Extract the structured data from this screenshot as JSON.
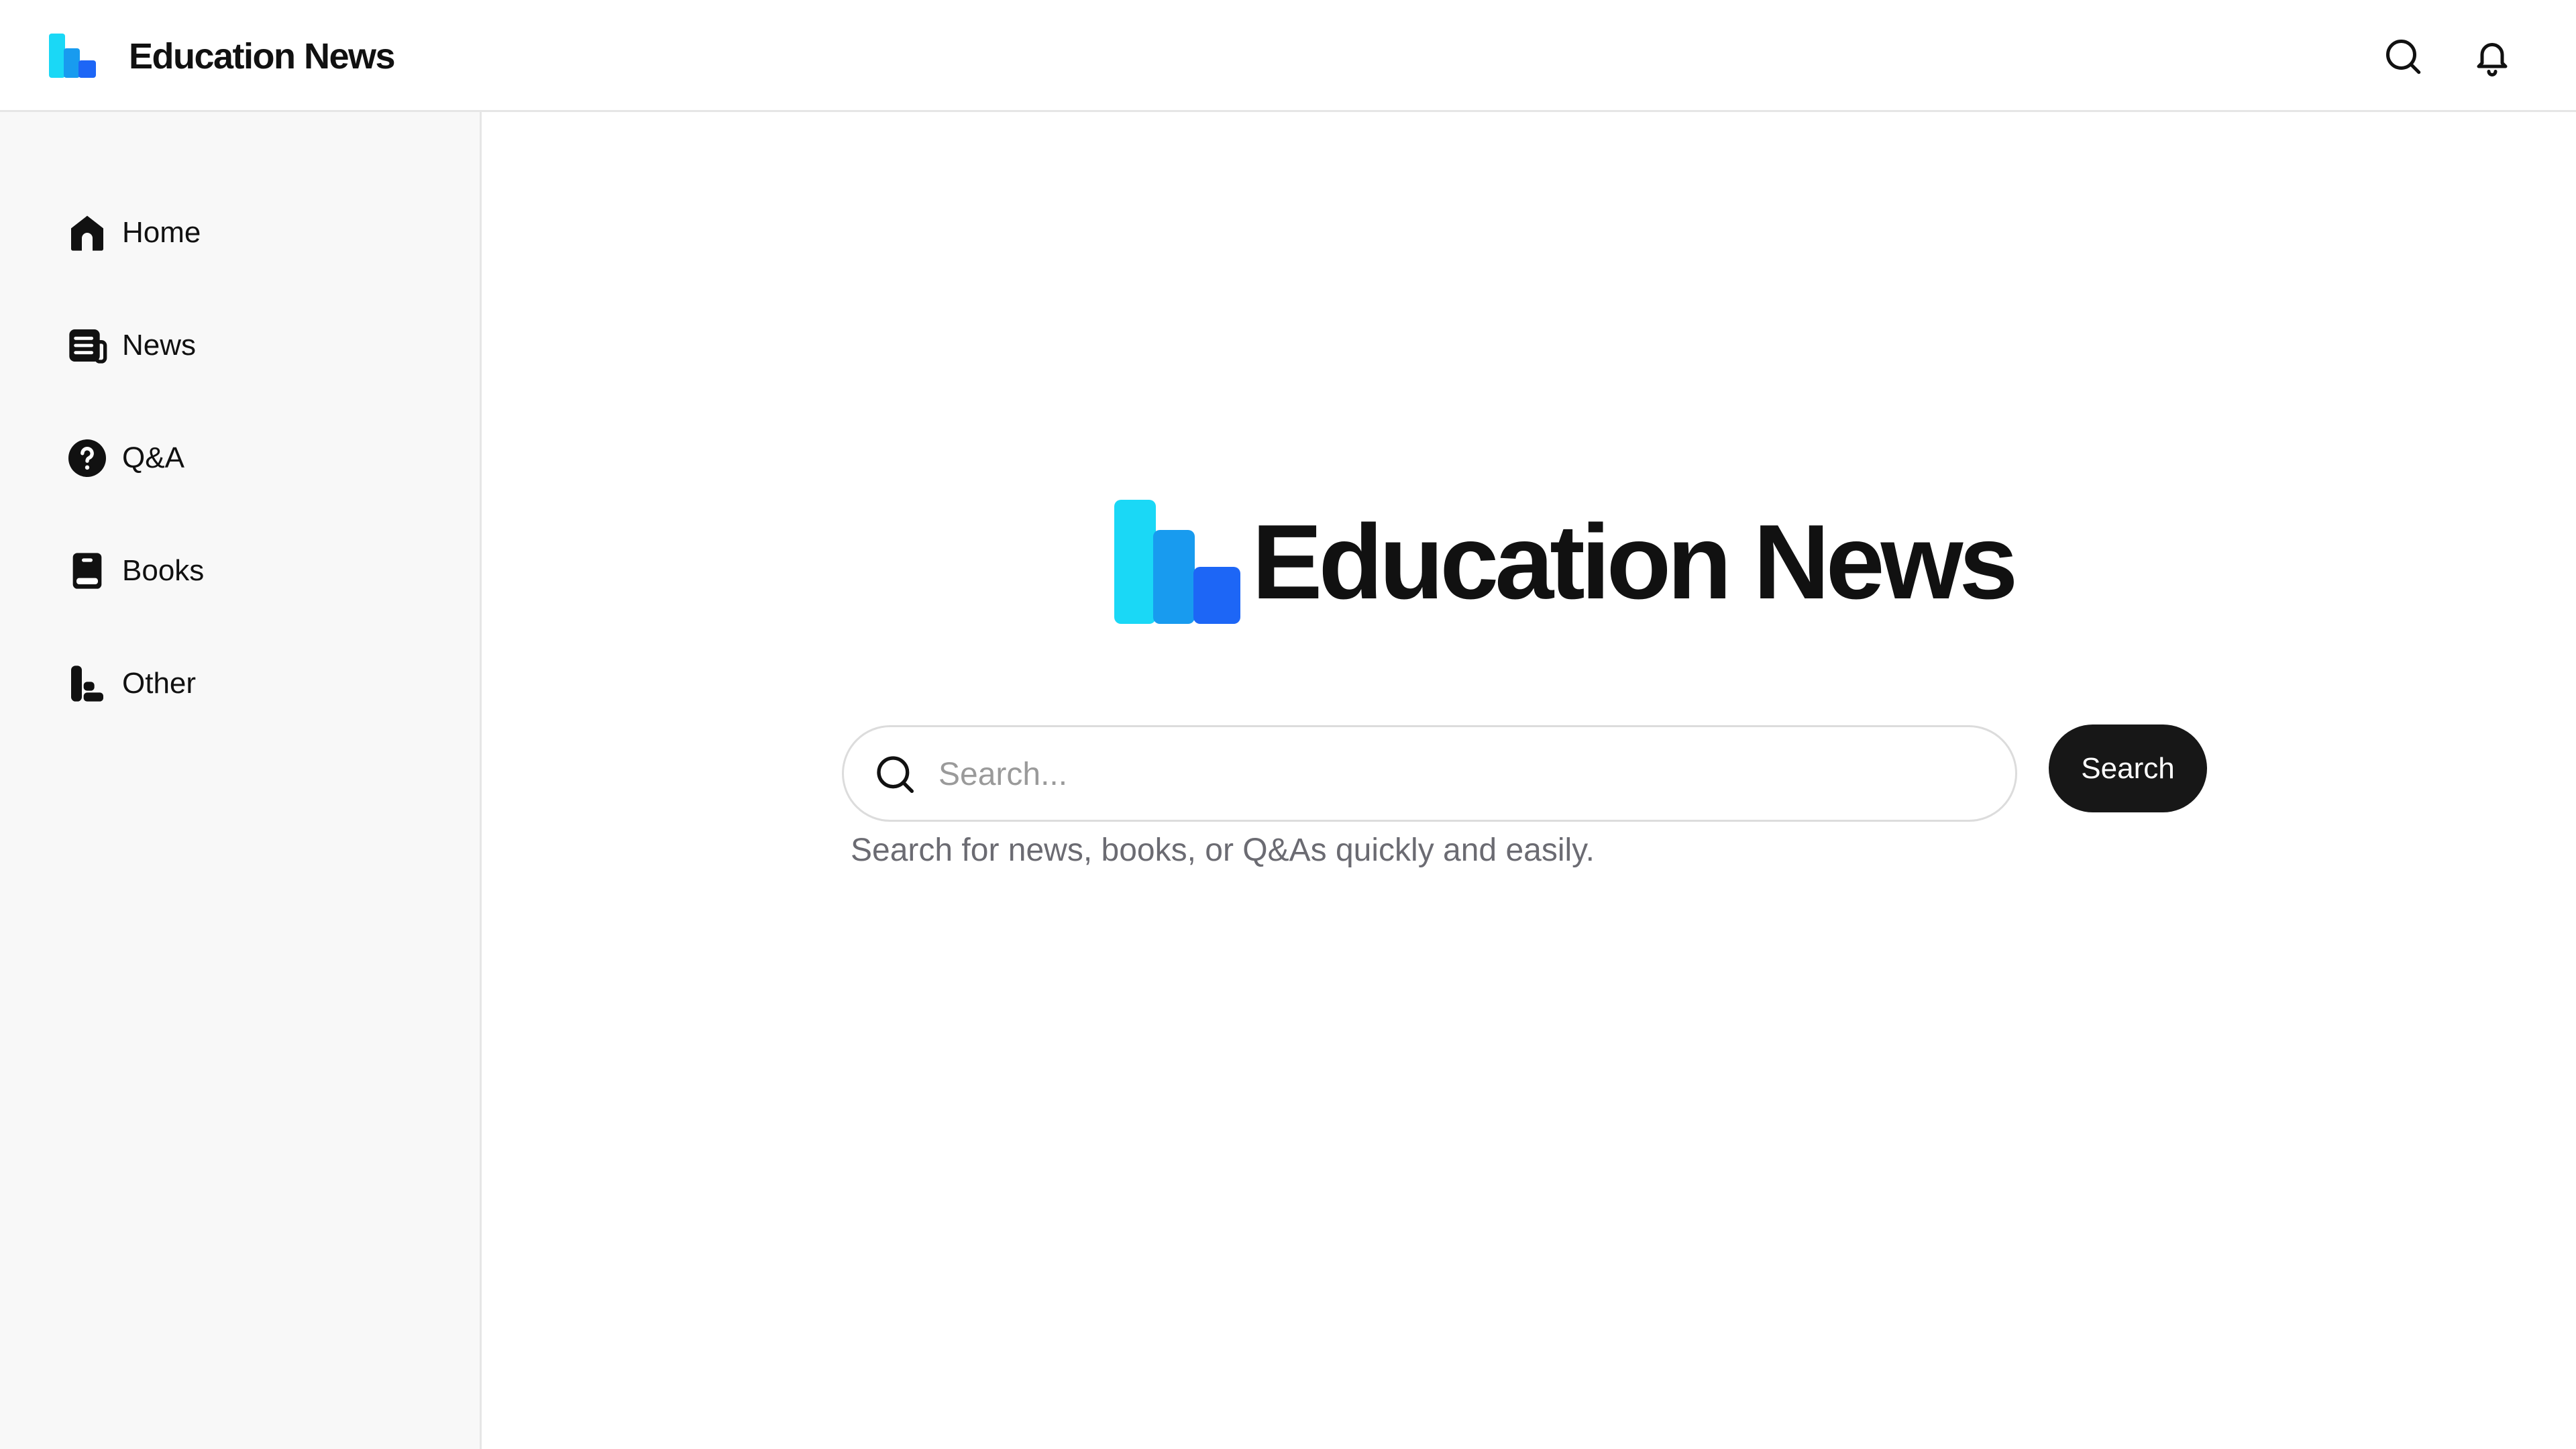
{
  "app": {
    "title": "Education News",
    "brand_colors": [
      "#1ad8f6",
      "#189bef",
      "#1d66f6"
    ]
  },
  "topbar": {
    "title": "Education News",
    "icons": [
      "search-icon",
      "bell-icon"
    ]
  },
  "sidebar": {
    "items": [
      {
        "label": "Home",
        "icon": "home-icon"
      },
      {
        "label": "News",
        "icon": "newspaper-icon"
      },
      {
        "label": "Q&A",
        "icon": "question-circle-icon"
      },
      {
        "label": "Books",
        "icon": "book-icon"
      },
      {
        "label": "Other",
        "icon": "blocks-icon"
      }
    ]
  },
  "main": {
    "title": "Education News",
    "search": {
      "placeholder": "Search...",
      "value": "",
      "button_label": "Search",
      "helper_text": "Search for news, books, or Q&As quickly and easily."
    }
  },
  "colors": {
    "button_bg": "#171717",
    "helper_text": "#6b6b72",
    "sidebar_bg": "#f8f8f8"
  }
}
